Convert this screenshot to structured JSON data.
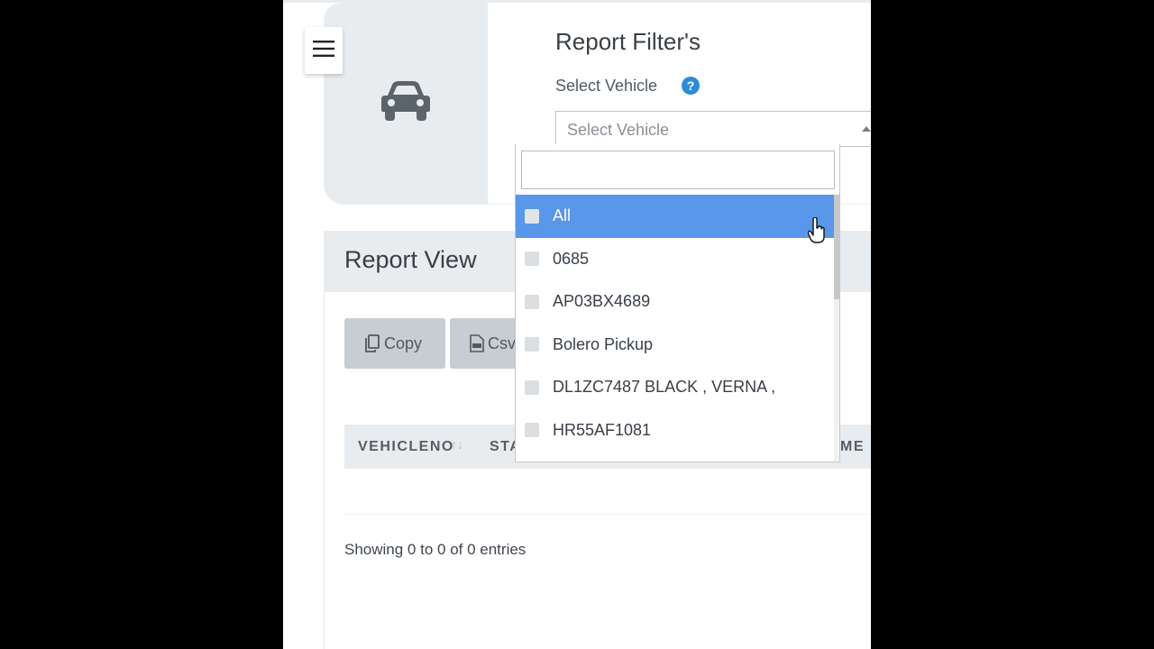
{
  "filters": {
    "title": "Report Filter's",
    "vehicle_label": "Select Vehicle",
    "help_icon": "question-circle-icon",
    "select_placeholder": "Select Vehicle",
    "search_value": "",
    "options": [
      {
        "label": "All",
        "highlighted": true
      },
      {
        "label": "0685"
      },
      {
        "label": "AP03BX4689"
      },
      {
        "label": "Bolero Pickup"
      },
      {
        "label": "DL1ZC7487 BLACK , VERNA ,"
      },
      {
        "label": "HR55AF1081"
      }
    ]
  },
  "report": {
    "title": "Report View",
    "buttons": {
      "copy_label": "Copy",
      "csv_label": "Csv"
    },
    "columns": [
      "VEHICLENO",
      "STA",
      "ME"
    ],
    "showing_text": "Showing 0 to 0 of 0 entries"
  },
  "colors": {
    "highlight": "#5897ea",
    "help": "#2d8ad8",
    "panel": "#e9ecef",
    "button": "#c8cdd2"
  },
  "icons": {
    "menu": "hamburger-menu-icon",
    "vehicle": "car-icon",
    "copy": "copy-icon",
    "csv": "csv-file-icon",
    "cursor": "hand-pointer-icon"
  }
}
